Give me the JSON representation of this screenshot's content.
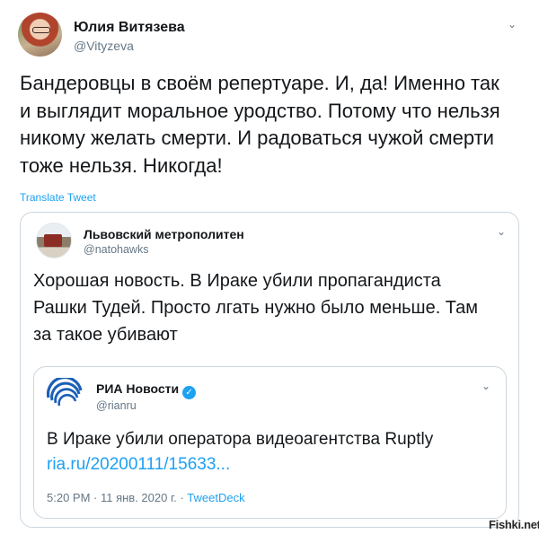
{
  "author": {
    "name": "Юлия Витязева",
    "handle": "@Vityzeva",
    "text_lines": [
      "Бандеровцы в своём репертуаре. И, да! Именно так",
      "и выглядит моральное уродство. Потому что нельзя",
      "никому желать смерти. И радоваться чужой смерти",
      "тоже нельзя. Никогда!"
    ]
  },
  "translate_label": "Translate Tweet",
  "quoted": {
    "name": "Львовский метрополитен",
    "handle": "@natohawks",
    "text_lines": [
      "Хорошая новость. В Ираке убили пропагандиста",
      "Рашки Тудей. Просто лгать нужно было меньше. Там",
      "за такое убивают"
    ]
  },
  "nested": {
    "name": "РИА Новости",
    "verified_glyph": "✓",
    "handle": "@rianru",
    "text": "В Ираке убили оператора видеоагентства Ruptly",
    "link": "ria.ru/20200111/15633...",
    "time": "5:20 PM · 11 янв. 2020 г. · ",
    "source": "TweetDeck"
  },
  "icons": {
    "caret": "⌄"
  },
  "watermark": "Fishki.net",
  "colors": {
    "link": "#1da1f2",
    "secondary_text": "#657786",
    "border": "#ccd6dd"
  }
}
